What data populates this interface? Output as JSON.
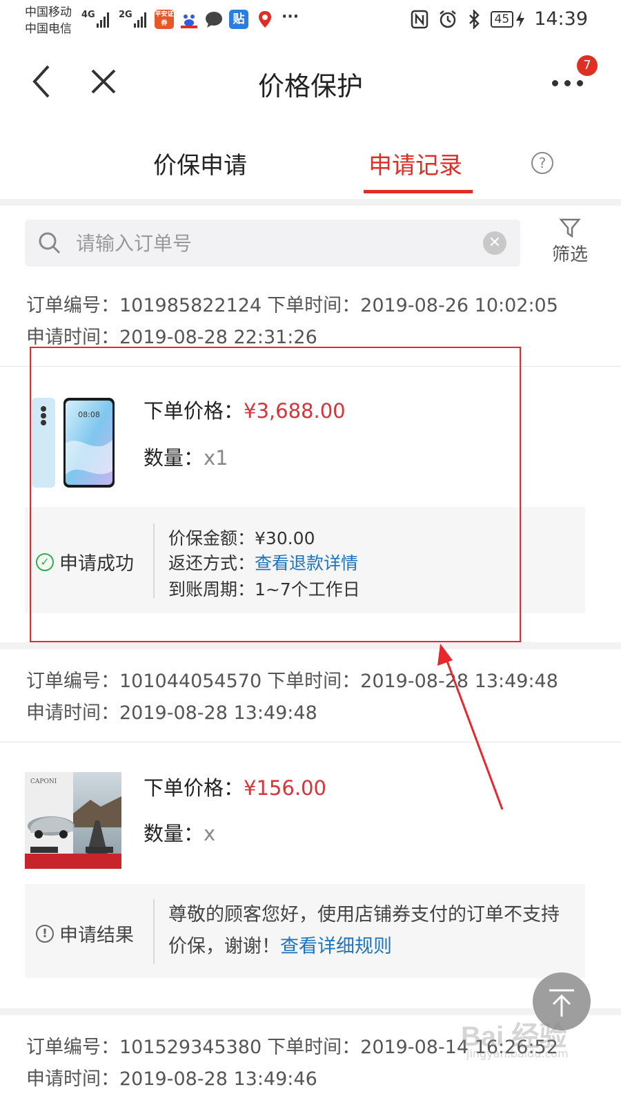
{
  "status_bar": {
    "carrier1": "中国移动",
    "carrier2": "中国电信",
    "net1": "4G",
    "net2": "2G",
    "app_icon_pingan": "平安证券",
    "app_icon_tieba": "贴",
    "more_dots": "···",
    "battery": "45",
    "time": "14:39"
  },
  "nav": {
    "title": "价格保护",
    "badge_count": "7"
  },
  "tabs": {
    "apply": "价保申请",
    "record": "申请记录",
    "help": "?"
  },
  "search": {
    "placeholder": "请输入订单号",
    "filter_label": "筛选"
  },
  "orders": [
    {
      "order_label": "订单编号：",
      "order_no": "101985822124",
      "order_time_label": "下单时间：",
      "order_time": "2019-08-26 10:02:05",
      "apply_time_label": "申请时间：",
      "apply_time": "2019-08-28 22:31:26",
      "price_label": "下单价格：",
      "price": "¥3,688.00",
      "qty_label": "数量：",
      "qty": "x1",
      "status": "申请成功",
      "refund_label": "价保金额：",
      "refund": "¥30.00",
      "method_label": "返还方式：",
      "method_link": "查看退款详情",
      "period_label": "到账周期：",
      "period": "1~7个工作日"
    },
    {
      "order_label": "订单编号：",
      "order_no": "101044054570",
      "order_time_label": "下单时间：",
      "order_time": "2019-08-28 13:49:48",
      "apply_time_label": "申请时间：",
      "apply_time": "2019-08-28 13:49:48",
      "price_label": "下单价格：",
      "price": "¥156.00",
      "qty_label": "数量：",
      "qty": "x",
      "status": "申请结果",
      "message": "尊敬的顾客您好，使用店铺券支付的订单不支持价保，谢谢！",
      "message_link": "查看详细规则",
      "product_brand": "CAPONI"
    },
    {
      "order_label": "订单编号：",
      "order_no": "101529345380",
      "order_time_label": "下单时间：",
      "order_time": "2019-08-14 16:26:52",
      "apply_time_label": "申请时间：",
      "apply_time": "2019-08-28 13:49:46"
    }
  ],
  "watermark": {
    "text": "Bai 经验",
    "sub": "jingyan.baidu.com"
  },
  "colors": {
    "accent": "#e02e24",
    "price": "#d7343a",
    "link": "#1e73be",
    "success": "#2bb24c"
  }
}
